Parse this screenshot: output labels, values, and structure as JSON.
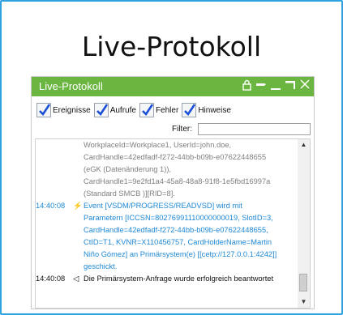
{
  "page_title": "Live-Protokoll",
  "window": {
    "title": "Live-Protokoll",
    "icons": [
      "lock-icon",
      "pin-icon",
      "minimize-icon",
      "maximize-icon",
      "close-icon"
    ]
  },
  "filters": [
    {
      "label": "Ereignisse",
      "checked": true
    },
    {
      "label": "Aufrufe",
      "checked": true
    },
    {
      "label": "Fehler",
      "checked": true
    },
    {
      "label": "Hinweise",
      "checked": true
    }
  ],
  "filter_field": {
    "label": "Filter:",
    "value": ""
  },
  "log": {
    "continuation": [
      "WorkplaceId=Workplace1, UserId=john.doe,",
      "CardHandle=42edfadf-f272-44bb-b09b-e07622448655",
      "(eGK (Datenänderung 1)),",
      "CardHandle1=9e2fd1a4-45a8-48a8-91f8-1e5fbd16997a",
      "(Standard SMCB )][RID=8]."
    ],
    "event_entry": {
      "time": "14:40:08",
      "symbol": "⚡",
      "lines": [
        "Event [VSDM/PROGRESS/READVSD] wird mit",
        "Parametern [ICCSN=80276991110000000019, SlotID=3,",
        "CardHandle=42edfadf-f272-44bb-b09b-e07622448655,",
        "CtID=T1, KVNR=X110456757, CardHolderName=Martin",
        "Niño Gómez] an Primärsystem(e) [[cetp://127.0.0.1:4242]]",
        "geschickt."
      ]
    },
    "request_entry": {
      "time": "14:40:08",
      "symbol": "◁",
      "lines": [
        "Die Primärsystem-Anfrage wurde erfolgreich beantwortet"
      ]
    }
  },
  "colors": {
    "frame_border": "#2fa3dd",
    "titlebar": "#6ab640",
    "event_text": "#1e88d4",
    "muted_text": "#7f7f7f",
    "checkbox_mark": "#1a4fd6"
  }
}
